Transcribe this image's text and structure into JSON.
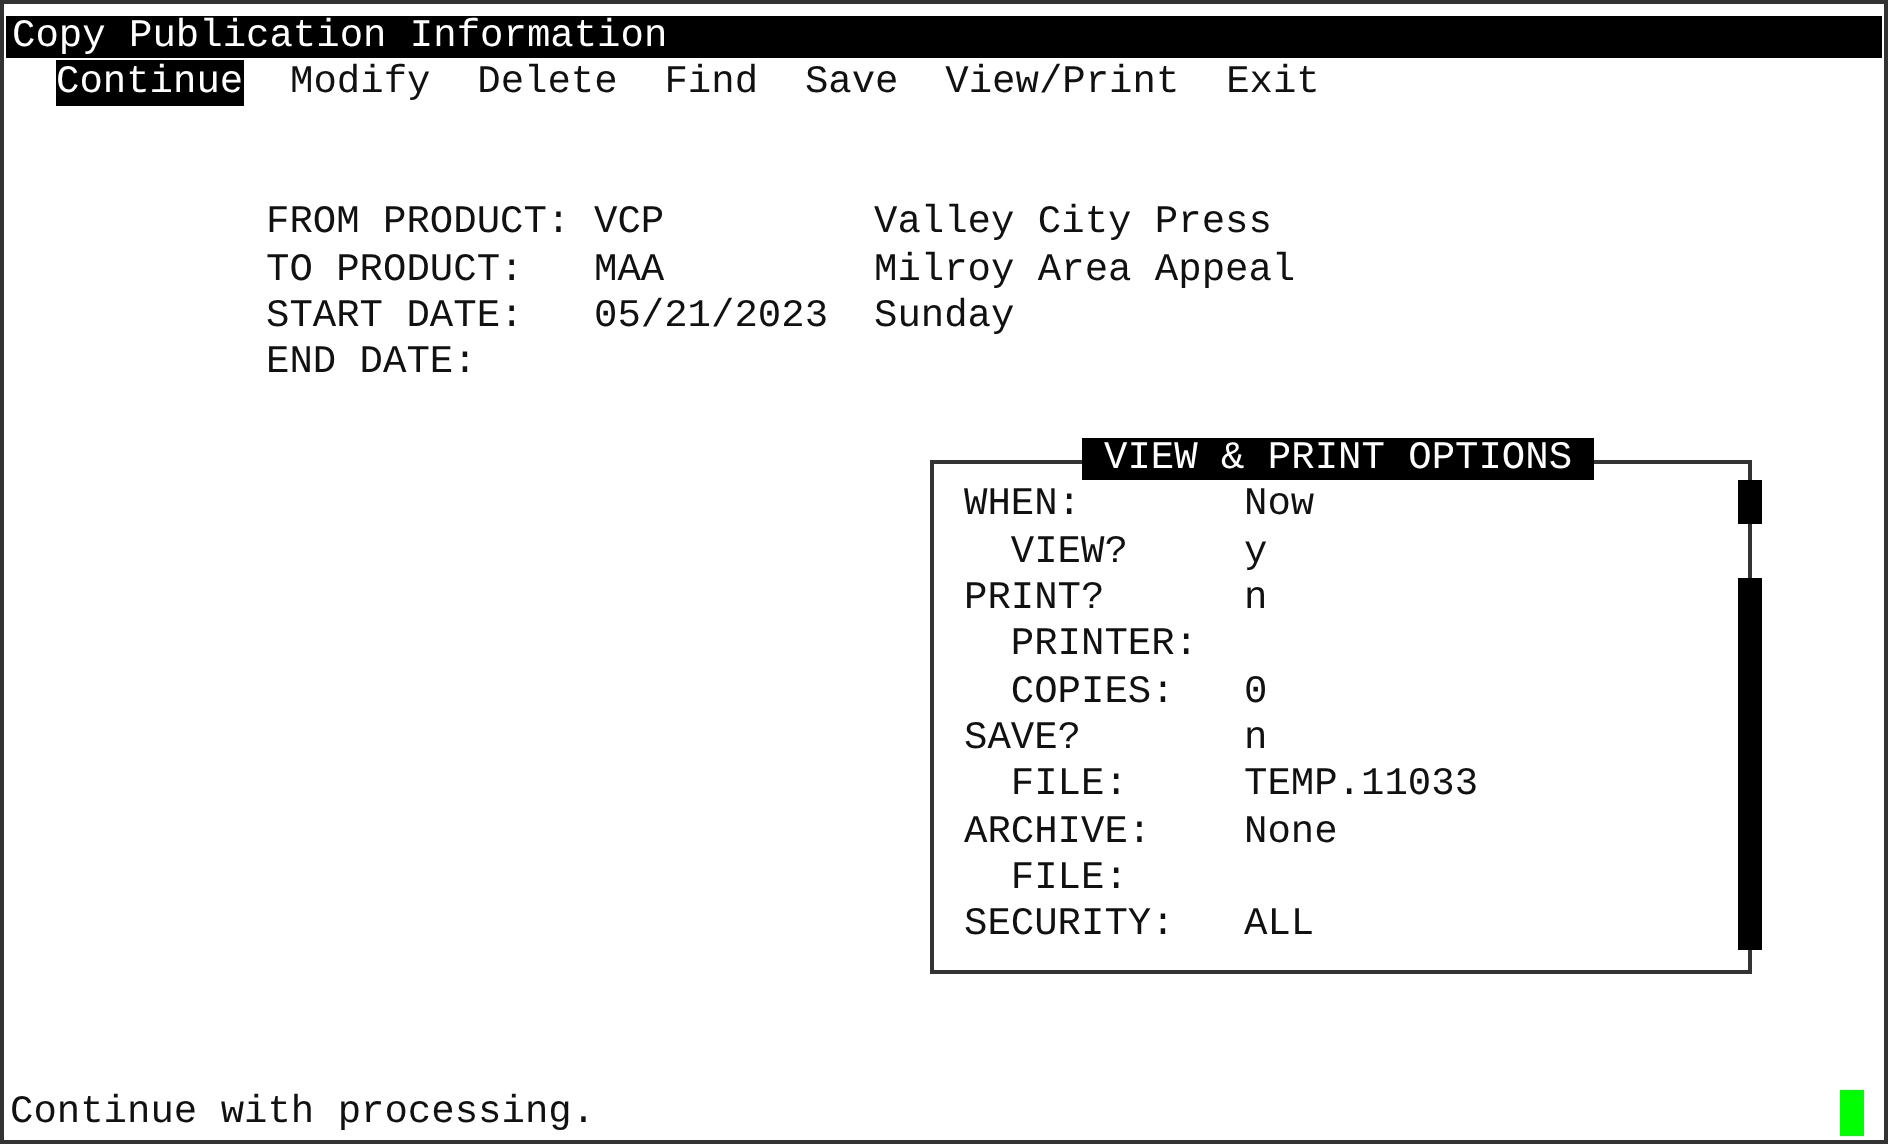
{
  "window": {
    "title": "Copy Publication Information"
  },
  "menu": [
    {
      "label": "Continue",
      "selected": true
    },
    {
      "label": "Modify",
      "selected": false
    },
    {
      "label": "Delete",
      "selected": false
    },
    {
      "label": "Find",
      "selected": false
    },
    {
      "label": "Save",
      "selected": false
    },
    {
      "label": "View/Print",
      "selected": false
    },
    {
      "label": "Exit",
      "selected": false
    }
  ],
  "fields": [
    {
      "label": "FROM PRODUCT:",
      "value": "VCP",
      "description": "Valley City Press"
    },
    {
      "label": "TO PRODUCT:",
      "value": "MAA",
      "description": "Milroy Area Appeal"
    },
    {
      "label": "START DATE:",
      "value": "05/21/2023",
      "description": "Sunday"
    },
    {
      "label": "END DATE:"
    }
  ],
  "options_panel": {
    "title": "VIEW & PRINT OPTIONS",
    "rows": [
      {
        "label": "WHEN:",
        "value": "Now",
        "children": [
          {
            "label": "VIEW?",
            "value": "y"
          }
        ]
      },
      {
        "label": "PRINT?",
        "value": "n",
        "children": [
          {
            "label": "PRINTER:"
          },
          {
            "label": "COPIES:",
            "value": "0"
          }
        ]
      },
      {
        "label": "SAVE?",
        "value": "n",
        "children": [
          {
            "label": "FILE:",
            "value": "TEMP.11033"
          }
        ]
      },
      {
        "label": "ARCHIVE:",
        "value": "None",
        "children": [
          {
            "label": "FILE:"
          }
        ]
      },
      {
        "label": "SECURITY:",
        "value": "ALL"
      }
    ]
  },
  "status_bar": {
    "text": "Continue with processing."
  }
}
